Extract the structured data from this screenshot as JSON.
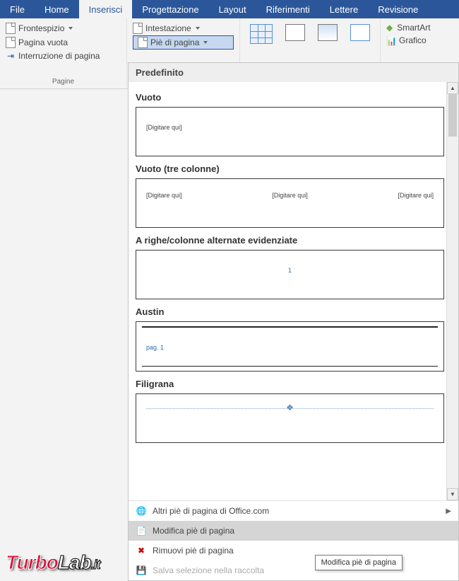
{
  "tabs": {
    "file": "File",
    "home": "Home",
    "inserisci": "Inserisci",
    "progettazione": "Progettazione",
    "layout": "Layout",
    "riferimenti": "Riferimenti",
    "lettere": "Lettere",
    "revisione": "Revisione"
  },
  "pagine_group": {
    "frontespizio": "Frontespizio",
    "pagina_vuota": "Pagina vuota",
    "interruzione": "Interruzione di pagina",
    "label": "Pagine"
  },
  "header_footer": {
    "intestazione": "Intestazione",
    "pie": "Piè di pagina"
  },
  "side_cmds": {
    "smartart": "SmartArt",
    "grafico": "Grafico"
  },
  "gallery": {
    "header": "Predefinito",
    "items": [
      {
        "title": "Vuoto",
        "ph": "[Digitare qui]"
      },
      {
        "title": "Vuoto (tre colonne)",
        "ph": "[Digitare qui]"
      },
      {
        "title": "A righe/colonne alternate evidenziate",
        "num": "1"
      },
      {
        "title": "Austin",
        "pg": "pag. 1"
      },
      {
        "title": "Filigrana"
      }
    ]
  },
  "menu": {
    "office": "Altri piè di pagina di Office.com",
    "modifica": "Modifica piè di pagina",
    "rimuovi": "Rimuovi piè di pagina",
    "salva": "Salva selezione nella raccolta"
  },
  "tooltip": "Modifica piè di pagina",
  "watermark": {
    "a": "Turbo",
    "b": "Lab",
    "c": ".it"
  }
}
